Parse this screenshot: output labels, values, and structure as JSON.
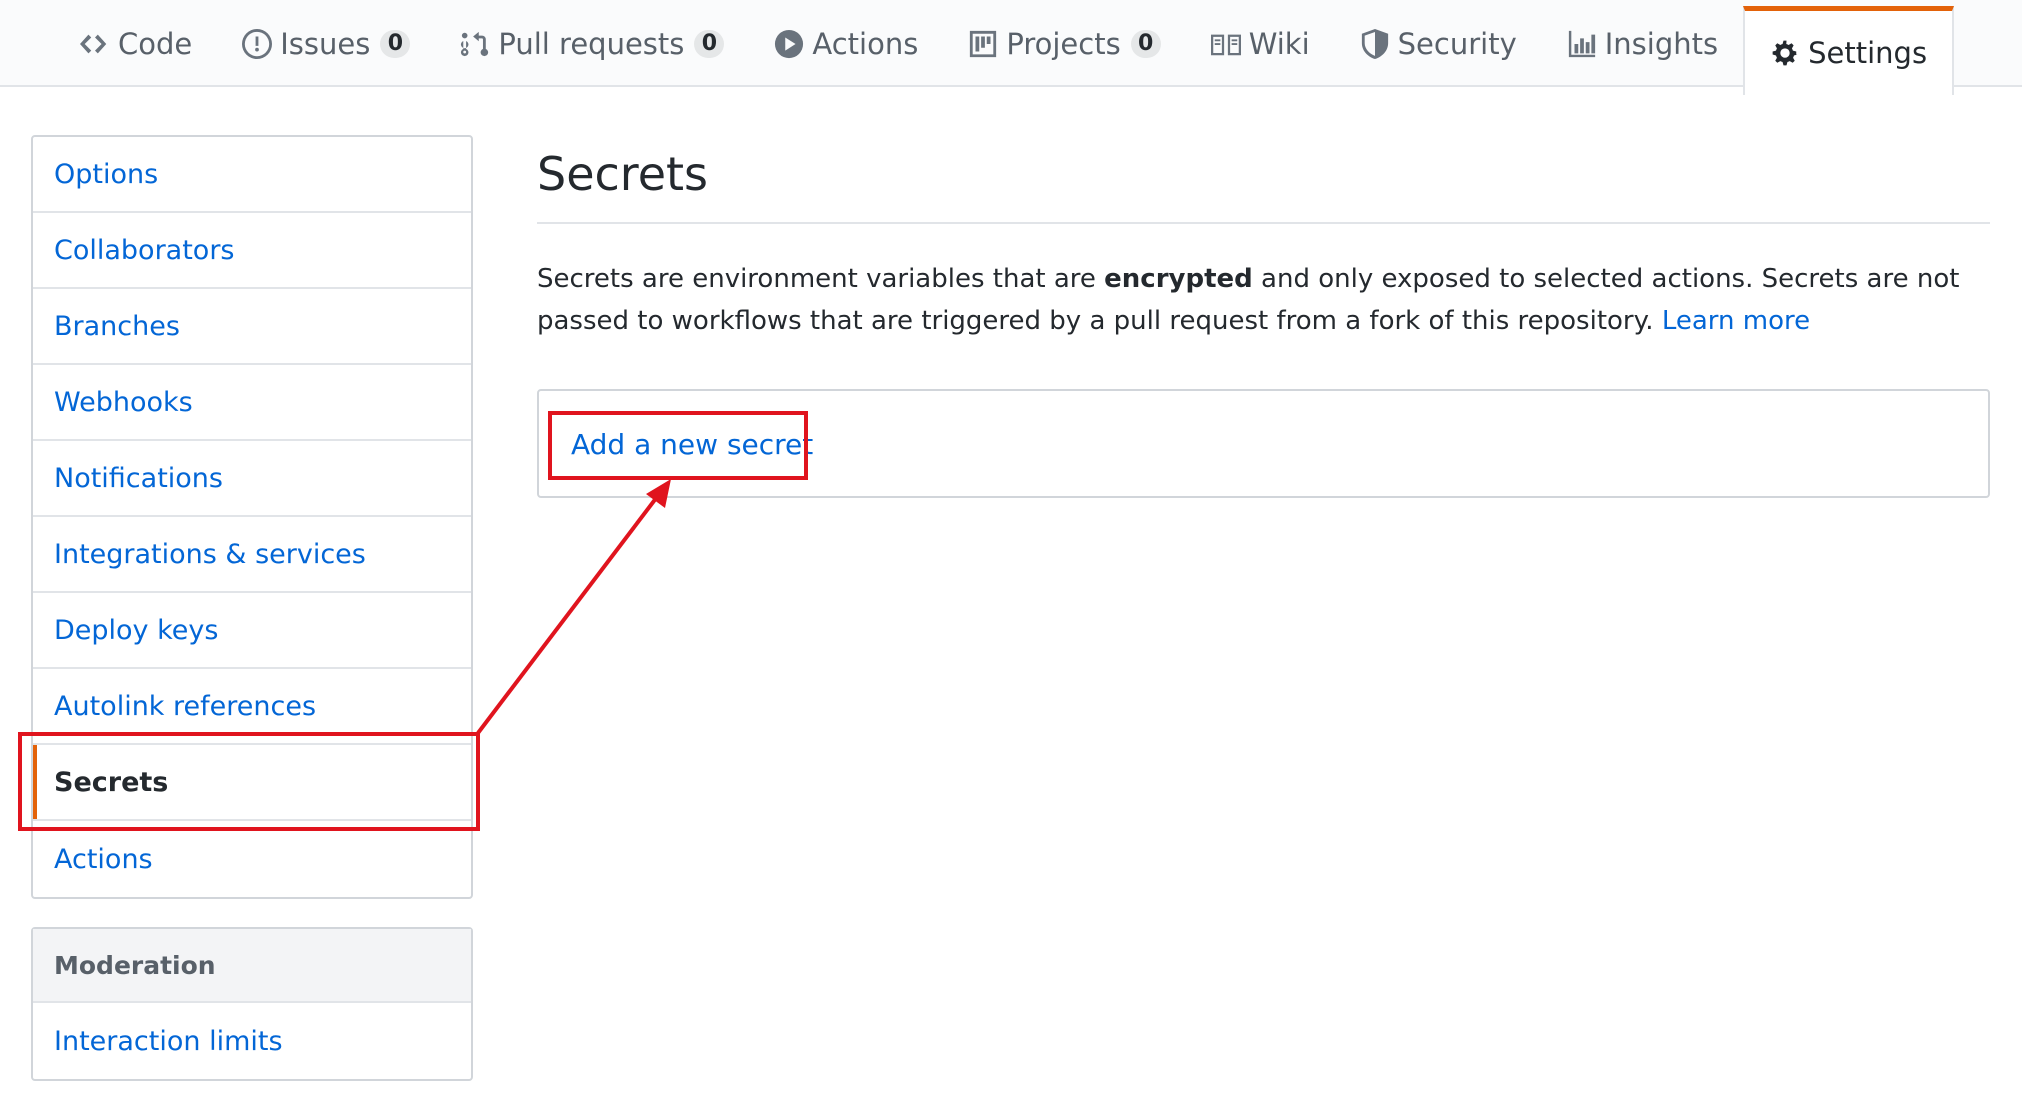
{
  "tabs": [
    {
      "label": "Code",
      "icon": "code-icon"
    },
    {
      "label": "Issues",
      "icon": "issue-opened-icon",
      "count": "0"
    },
    {
      "label": "Pull requests",
      "icon": "git-pull-request-icon",
      "count": "0"
    },
    {
      "label": "Actions",
      "icon": "play-icon"
    },
    {
      "label": "Projects",
      "icon": "project-icon",
      "count": "0"
    },
    {
      "label": "Wiki",
      "icon": "book-icon"
    },
    {
      "label": "Security",
      "icon": "shield-icon"
    },
    {
      "label": "Insights",
      "icon": "graph-icon"
    },
    {
      "label": "Settings",
      "icon": "gear-icon",
      "selected": true
    }
  ],
  "sidebar": {
    "items": [
      {
        "label": "Options"
      },
      {
        "label": "Collaborators"
      },
      {
        "label": "Branches"
      },
      {
        "label": "Webhooks"
      },
      {
        "label": "Notifications"
      },
      {
        "label": "Integrations & services"
      },
      {
        "label": "Deploy keys"
      },
      {
        "label": "Autolink references"
      },
      {
        "label": "Secrets",
        "active": true
      },
      {
        "label": "Actions"
      }
    ],
    "moderation": {
      "heading": "Moderation",
      "items": [
        {
          "label": "Interaction limits"
        }
      ]
    }
  },
  "main": {
    "title": "Secrets",
    "description": {
      "before": "Secrets are environment variables that are ",
      "bold": "encrypted",
      "after": " and only exposed to selected actions. Secrets are not passed to workflows that are triggered by a pull request from a fork of this repository. ",
      "link": "Learn more"
    },
    "add_secret_label": "Add a new secret"
  },
  "colors": {
    "accent_orange": "#e36209",
    "link_blue": "#0366d6",
    "annotation_red": "#e0141e"
  }
}
